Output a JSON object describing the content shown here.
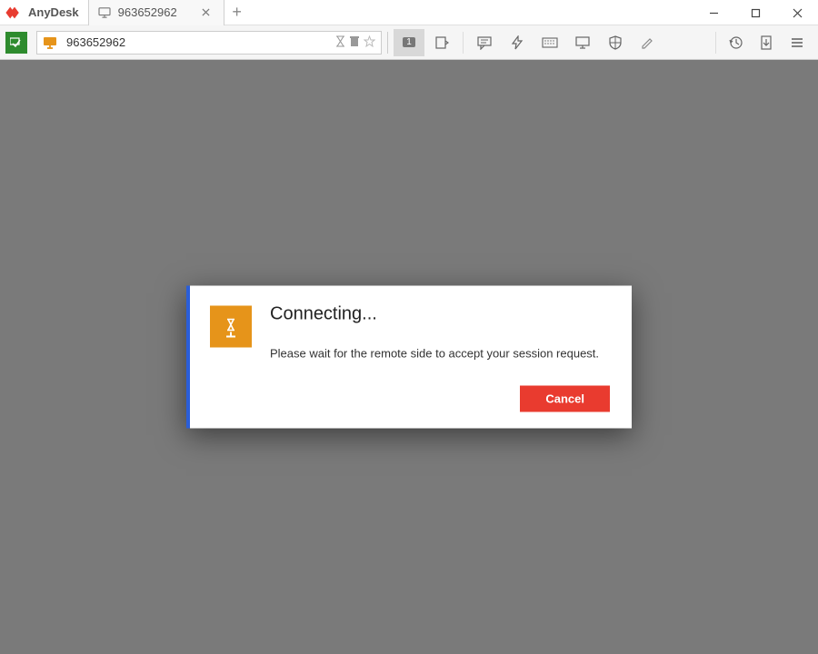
{
  "app": {
    "name": "AnyDesk"
  },
  "tab": {
    "title": "963652962"
  },
  "address": {
    "value": "963652962"
  },
  "toolbar": {
    "screen_badge": "1"
  },
  "dialog": {
    "title": "Connecting...",
    "message": "Please wait for the remote side to accept your session request.",
    "cancel": "Cancel"
  }
}
